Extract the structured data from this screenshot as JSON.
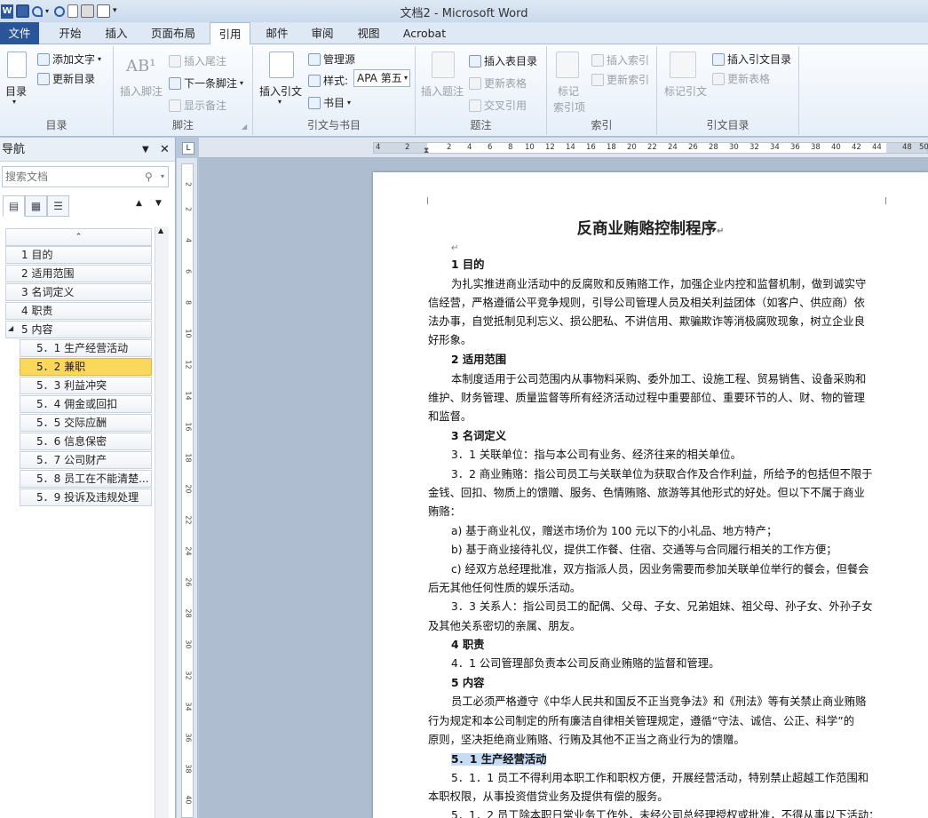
{
  "window": {
    "title": "文档2 - Microsoft Word"
  },
  "tabs": [
    {
      "label": "文件"
    },
    {
      "label": "开始"
    },
    {
      "label": "插入"
    },
    {
      "label": "页面布局"
    },
    {
      "label": "引用"
    },
    {
      "label": "邮件"
    },
    {
      "label": "审阅"
    },
    {
      "label": "视图"
    },
    {
      "label": "Acrobat"
    }
  ],
  "ribbon": {
    "toc": {
      "big": "目录",
      "add_text": "添加文字",
      "update_toc": "更新目录",
      "group": "目录"
    },
    "footnote": {
      "insert_footnote": "插入脚注",
      "insert_endnote": "插入尾注",
      "next_footnote": "下一条脚注",
      "show_notes": "显示备注",
      "group": "脚注"
    },
    "citations": {
      "insert_citation": "插入引文",
      "manage_sources": "管理源",
      "style_label": "样式:",
      "style_value": "APA 第五",
      "bibliography": "书目",
      "group": "引文与书目"
    },
    "captions": {
      "insert_caption": "插入题注",
      "insert_table_figures": "插入表目录",
      "update_table": "更新表格",
      "cross_reference": "交叉引用",
      "group": "题注"
    },
    "index": {
      "mark_entry_line1": "标记",
      "mark_entry_line2": "索引项",
      "insert_index": "插入索引",
      "update_index": "更新索引",
      "group": "索引"
    },
    "toa": {
      "mark_citation": "标记引文",
      "insert_toa": "插入引文目录",
      "update_table": "更新表格",
      "group": "引文目录"
    }
  },
  "nav": {
    "title": "导航",
    "search_placeholder": "搜索文档",
    "headings": [
      {
        "label": "1 目的"
      },
      {
        "label": "2 适用范围"
      },
      {
        "label": "3 名词定义"
      },
      {
        "label": "4 职责"
      },
      {
        "label": "5 内容"
      },
      {
        "label": "5．1 生产经营活动"
      },
      {
        "label": "5．2 兼职"
      },
      {
        "label": "5．3 利益冲突"
      },
      {
        "label": "5．4 佣金或回扣"
      },
      {
        "label": "5．5 交际应酬"
      },
      {
        "label": "5．6 信息保密"
      },
      {
        "label": "5．7 公司财产"
      },
      {
        "label": "5．8 员工在不能清楚..."
      },
      {
        "label": "5．9 投诉及违规处理"
      }
    ]
  },
  "ruler": {
    "h_numbers": [
      "4",
      "2",
      "2",
      "4",
      "6",
      "8",
      "10",
      "12",
      "14",
      "16",
      "18",
      "20",
      "22",
      "24",
      "26",
      "28",
      "30",
      "32",
      "34",
      "36",
      "38",
      "40",
      "42",
      "44",
      "48",
      "50"
    ],
    "v_numbers": [
      "2",
      "2",
      "4",
      "6",
      "8",
      "10",
      "12",
      "14",
      "16",
      "18",
      "20",
      "22",
      "24",
      "26",
      "28",
      "30",
      "32",
      "34",
      "36",
      "38",
      "40"
    ]
  },
  "document": {
    "title": "反商业贿赂控制程序",
    "lines": [
      "1 目的",
      "为扎实推进商业活动中的反腐败和反贿赂工作，加强企业内控和监督机制，做到诚实守",
      "信经营，严格遵循公平竞争规则，引导公司管理人员及相关利益团体（如客户、供应商）依",
      "法办事，自觉抵制见利忘义、损公肥私、不讲信用、欺骗欺诈等消极腐败现象，树立企业良",
      "好形象。",
      "2 适用范围",
      "本制度适用于公司范围内从事物料采购、委外加工、设施工程、贸易销售、设备采购和",
      "维护、财务管理、质量监督等所有经济活动过程中重要部位、重要环节的人、财、物的管理",
      "和监督。",
      "3 名词定义",
      "3．1 关联单位：指与本公司有业务、经济往来的相关单位。",
      "3．2 商业贿赂：指公司员工与关联单位为获取合作及合作利益，所给予的包括但不限于",
      "金钱、回扣、物质上的馈赠、服务、色情贿赂、旅游等其他形式的好处。但以下不属于商业",
      "贿赂：",
      "a) 基于商业礼仪，赠送市场价为 100 元以下的小礼品、地方特产；",
      "b) 基于商业接待礼仪，提供工作餐、住宿、交通等与合同履行相关的工作方便；",
      "c) 经双方总经理批准，双方指派人员，因业务需要而参加关联单位举行的餐会，但餐会",
      "后无其他任何性质的娱乐活动。",
      "3．3 关系人：指公司员工的配偶、父母、子女、兄弟姐妹、祖父母、孙子女、外孙子女",
      "及其他关系密切的亲属、朋友。",
      "4 职责",
      "4．1 公司管理部负责本公司反商业贿赂的监督和管理。",
      "5 内容",
      "员工必须严格遵守《中华人民共和国反不正当竞争法》和《刑法》等有关禁止商业贿赂",
      "行为规定和本公司制定的所有廉洁自律相关管理规定，遵循“守法、诚信、公正、科学”的",
      "原则，坚决拒绝商业贿赂、行贿及其他不正当之商业行为的馈赠。",
      "5．1 生产经营活动",
      "5．1．1 员工不得利用本职工作和职权方便，开展经营活动，特别禁止超越工作范围和",
      "本职权限，从事投资借贷业务及提供有偿的服务。",
      "5．1．2 员工除本职日常业务工作外，未经公司总经理授权或批准，不得从事以下活动："
    ]
  }
}
